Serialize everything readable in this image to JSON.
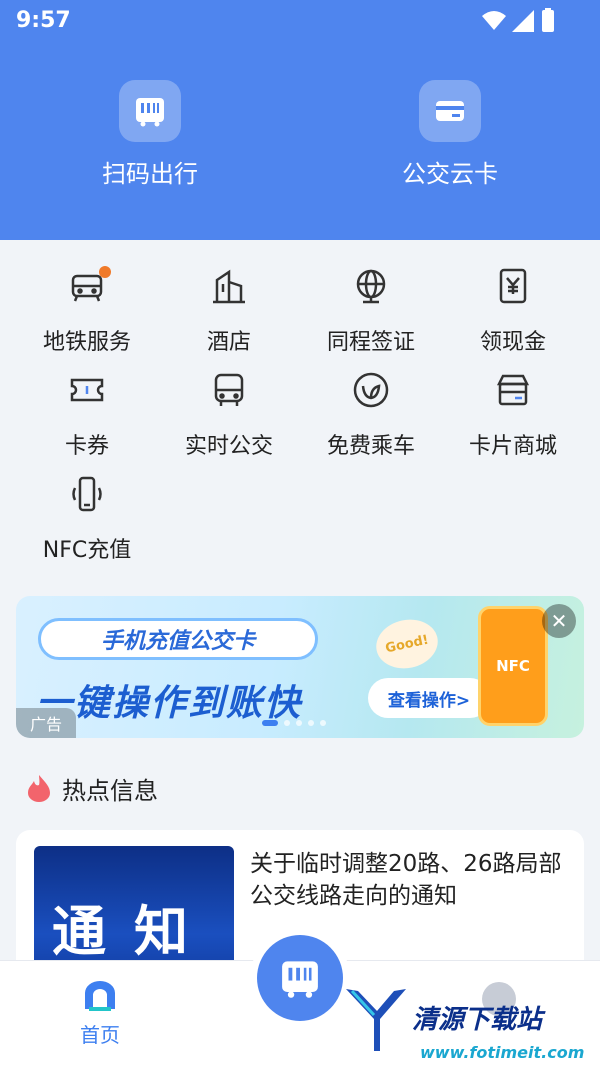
{
  "status_bar": {
    "time": "9:57"
  },
  "header": {
    "buttons": [
      {
        "label": "扫码出行",
        "icon": "bus-qr-icon"
      },
      {
        "label": "公交云卡",
        "icon": "card-icon"
      }
    ]
  },
  "services": [
    {
      "label": "地铁服务",
      "icon": "metro-icon",
      "badge": true
    },
    {
      "label": "酒店",
      "icon": "hotel-icon"
    },
    {
      "label": "同程签证",
      "icon": "globe-icon"
    },
    {
      "label": "领现金",
      "icon": "yuan-icon"
    },
    {
      "label": "卡券",
      "icon": "ticket-icon"
    },
    {
      "label": "实时公交",
      "icon": "bus-icon"
    },
    {
      "label": "免费乘车",
      "icon": "leaf-icon"
    },
    {
      "label": "卡片商城",
      "icon": "store-icon"
    },
    {
      "label": "NFC充值",
      "icon": "nfc-phone-icon"
    }
  ],
  "banner": {
    "pill": "手机充值公交卡",
    "headline": "一键操作到账快",
    "cta": "查看操作>",
    "bubble": "Good!",
    "phone_text": "NFC",
    "ad_tag": "广告",
    "close": "✕"
  },
  "hot_section": {
    "title": "热点信息"
  },
  "news": [
    {
      "thumb_text": "通知",
      "title": "关于临时调整20路、26路局部公交线路走向的通知"
    }
  ],
  "tabbar": {
    "home": "首页"
  },
  "watermark": {
    "name": "清源下载站",
    "url": "www.fotimeit.com"
  },
  "colors": {
    "primary": "#4f85ee",
    "badge": "#f07a2a"
  }
}
